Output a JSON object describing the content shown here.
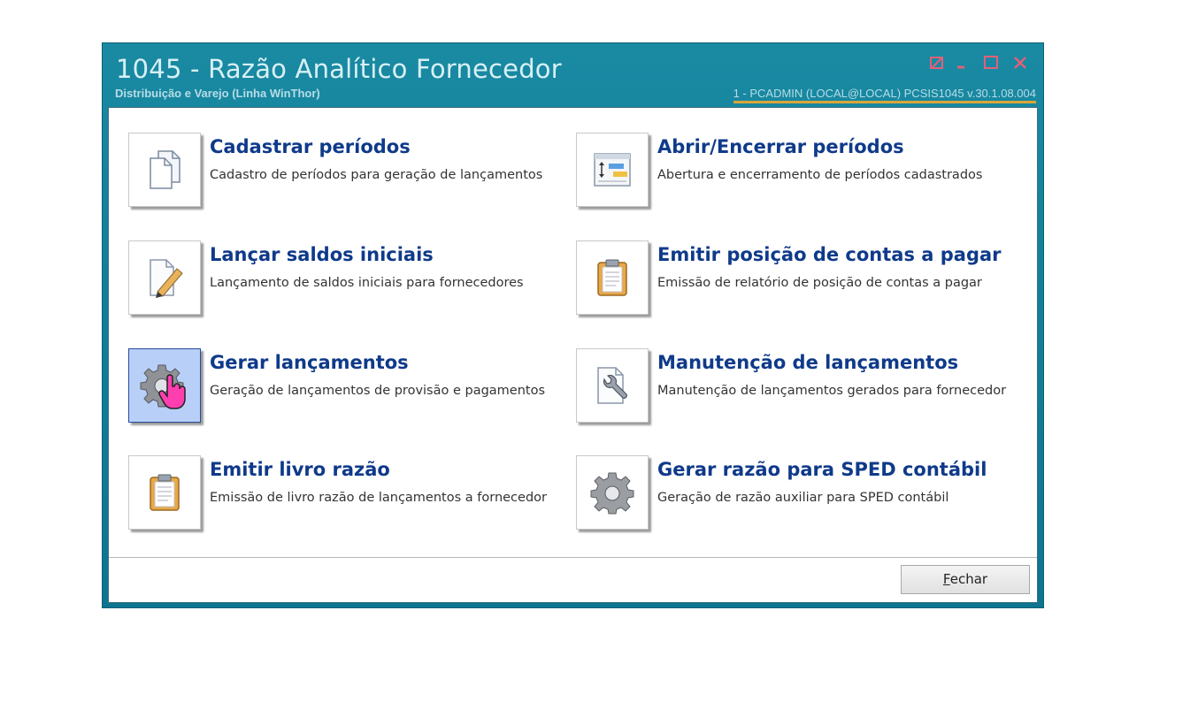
{
  "window": {
    "title": "1045 - Razão Analítico Fornecedor",
    "subtitle": "Distribuição e Varejo (Linha WinThor)",
    "userinfo": "1 - PCADMIN (LOCAL@LOCAL)   PCSIS1045  v.30.1.08.004"
  },
  "tiles": [
    {
      "title": "Cadastrar períodos",
      "desc": "Cadastro de períodos para geração de lançamentos",
      "icon": "documents-icon"
    },
    {
      "title": "Abrir/Encerrar períodos",
      "desc": "Abertura e encerramento de períodos cadastrados",
      "icon": "period-toggle-icon"
    },
    {
      "title": "Lançar saldos iniciais",
      "desc": "Lançamento de saldos iniciais para fornecedores",
      "icon": "edit-document-icon"
    },
    {
      "title": "Emitir posição de contas a pagar",
      "desc": "Emissão de relatório de posição de contas a pagar",
      "icon": "clipboard-icon"
    },
    {
      "title": "Gerar lançamentos",
      "desc": "Geração de lançamentos de provisão e pagamentos",
      "icon": "gear-icon"
    },
    {
      "title": "Manutenção de lançamentos",
      "desc": "Manutenção de lançamentos gerados para fornecedor",
      "icon": "wrench-document-icon"
    },
    {
      "title": "Emitir livro razão",
      "desc": "Emissão de livro razão de lançamentos a fornecedor",
      "icon": "clipboard-icon"
    },
    {
      "title": "Gerar razão para SPED contábil",
      "desc": "Geração de razão auxiliar para SPED contábil",
      "icon": "gear-icon"
    }
  ],
  "footer": {
    "close_label_first": "F",
    "close_label_rest": "echar"
  },
  "colors": {
    "window_frame": "#127f98",
    "tile_title": "#0f3a8a",
    "active_tile": "#b8d0f8"
  }
}
